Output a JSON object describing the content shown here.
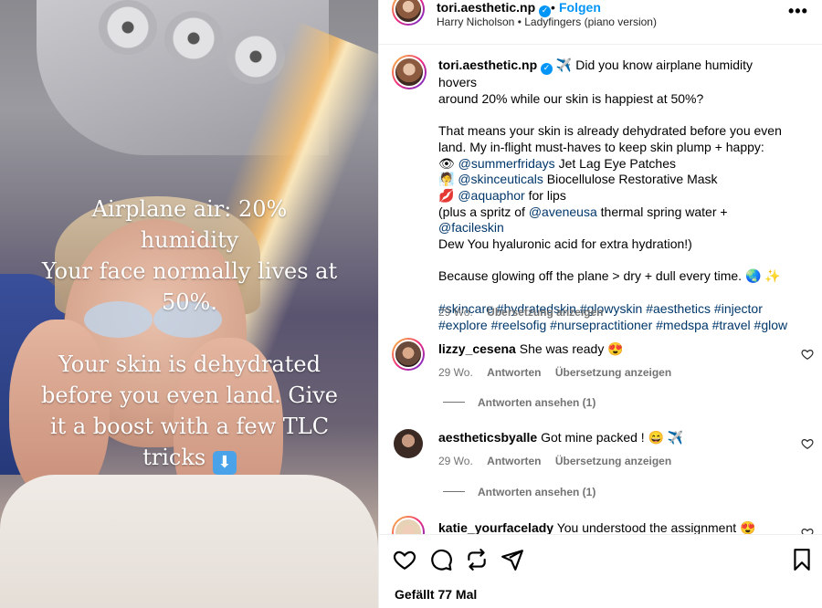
{
  "post": {
    "username": "tori.aesthetic.np",
    "follow_label": "Folgen",
    "separator": "•",
    "audio": "Harry Nicholson • Ladyfingers (piano version)",
    "more_icon": "more-horizontal-icon",
    "overlay": {
      "line1": "Airplane air: 20%",
      "line2": "humidity",
      "line3": "Your face normally lives at",
      "line4": "50%.",
      "line5": "Your skin is dehydrated",
      "line6": "before you even land. Give",
      "line7": "it a boost with a few TLC",
      "line8": "tricks"
    }
  },
  "caption": {
    "username": "tori.aesthetic.np",
    "line1": "Did you know airplane humidity hovers",
    "line2": "around 20% while our skin is happiest at 50%?",
    "line3": "That means your skin is already dehydrated before you even",
    "line4": "land. My in-flight must-haves to keep skin plump + happy:",
    "item1_mention": "@summerfridays",
    "item1_text": "Jet Lag Eye Patches",
    "item2_mention": "@skinceuticals",
    "item2_text": "Biocellulose Restorative Mask",
    "item3_mention": "@aquaphor",
    "item3_text": "for lips",
    "line8_pre": "(plus a spritz of",
    "line8_mention1": "@aveneusa",
    "line8_mid": "thermal spring water +",
    "line8_mention2": "@facileskin",
    "line9": "Dew You hyaluronic acid for extra hydration!)",
    "line10": "Because glowing off the plane > dry + dull every time.",
    "hashtags1": "#skincare #hydratedskin #glowyskin #aesthetics #injector",
    "hashtags2": "#explore #reelsofig #nursepractitioner #medspa #travel #glow",
    "time": "29 Wo.",
    "translate": "Übersetzung anzeigen"
  },
  "comments": [
    {
      "username": "lizzy_cesena",
      "text": "She was ready",
      "time": "29 Wo.",
      "reply": "Antworten",
      "translate": "Übersetzung anzeigen",
      "view_replies": "Antworten ansehen (1)"
    },
    {
      "username": "aestheticsbyalle",
      "text": "Got mine packed !",
      "time": "29 Wo.",
      "reply": "Antworten",
      "translate": "Übersetzung anzeigen",
      "view_replies": "Antworten ansehen (1)"
    },
    {
      "username": "katie_yourfacelady",
      "text": "You understood the assignment"
    }
  ],
  "actions": {
    "likes": "Gefällt 77 Mal"
  },
  "colors": {
    "link": "#00376b",
    "follow": "#0095f6",
    "muted": "#737373"
  }
}
